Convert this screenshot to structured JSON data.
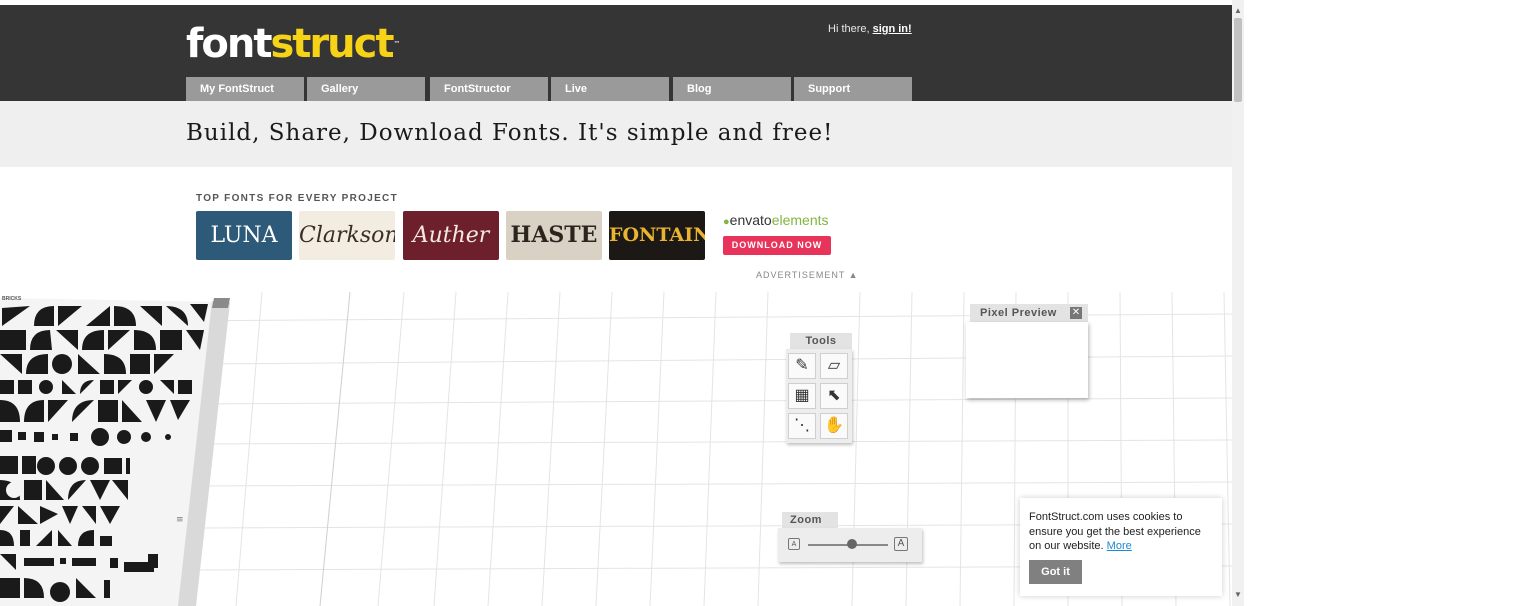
{
  "header": {
    "logo_part1": "font",
    "logo_part2": "struct",
    "logo_tm": "™",
    "greeting": "Hi there,",
    "sign_in": "sign in!"
  },
  "nav": {
    "tabs": [
      {
        "label": "My FontStruct"
      },
      {
        "label": "Gallery"
      },
      {
        "label": "FontStructor"
      },
      {
        "label": "Live"
      },
      {
        "label": "Blog"
      },
      {
        "label": "Support"
      }
    ]
  },
  "tagline": "Build, Share, Download Fonts. It's simple and free!",
  "ad": {
    "title": "TOP FONTS FOR EVERY PROJECT",
    "thumbnails": [
      {
        "label": "LUNA",
        "bg": "#2d5a78",
        "fg": "#ffffff"
      },
      {
        "label": "Clarkson",
        "bg": "#f3ece0",
        "fg": "#3a2d26"
      },
      {
        "label": "Auther",
        "bg": "#6e1f2c",
        "fg": "#f3e9dd"
      },
      {
        "label": "HASTE",
        "bg": "#d9d2c4",
        "fg": "#2b2520"
      },
      {
        "label": "FONTAINE",
        "bg": "#1b1815",
        "fg": "#e9b430"
      }
    ],
    "brand_leaf": "●",
    "brand_part1": "envato",
    "brand_part2": "elements",
    "download_label": "DOWNLOAD NOW",
    "advertisement_label": "ADVERTISEMENT ▲"
  },
  "editor": {
    "palette_label": "BRICKS",
    "tools": {
      "title": "Tools",
      "items": [
        {
          "name": "pencil-icon",
          "glyph": "✎"
        },
        {
          "name": "eraser-icon",
          "glyph": "▱"
        },
        {
          "name": "filled-grid-icon",
          "glyph": "▦"
        },
        {
          "name": "select-arrow-icon",
          "glyph": "⬉"
        },
        {
          "name": "line-icon",
          "glyph": "⋱"
        },
        {
          "name": "hand-icon",
          "glyph": "✋"
        }
      ]
    },
    "pixel_preview": {
      "title": "Pixel Preview",
      "close_glyph": "✕"
    },
    "zoom": {
      "title": "Zoom",
      "min_glyph": "A",
      "max_glyph": "A",
      "level": 0.55
    }
  },
  "cookie": {
    "message": "FontStruct.com uses cookies to ensure you get the best experience on our website.",
    "more_link": "More",
    "button": "Got it"
  },
  "colors": {
    "header_bg": "#353535",
    "logo_yellow": "#f7d318",
    "nav_tab": "#9a9a9a",
    "envato_green": "#82b541",
    "download_pink": "#e8345a",
    "link_blue": "#1a8ad4"
  }
}
